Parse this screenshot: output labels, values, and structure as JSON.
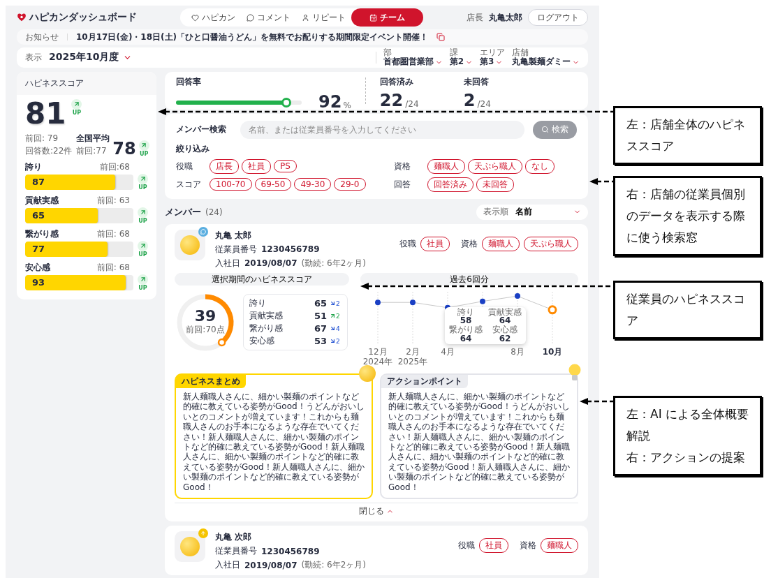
{
  "header": {
    "logo": "ハピカンダッシュボード",
    "nav": [
      {
        "label": "ハピカン",
        "selected": false
      },
      {
        "label": "コメント",
        "selected": false
      },
      {
        "label": "リピート",
        "selected": false
      },
      {
        "label": "チーム",
        "selected": true
      }
    ],
    "user_role": "店長",
    "user_name": "丸亀太郎",
    "logout": "ログアウト"
  },
  "notice": {
    "label": "お知らせ",
    "text": "10月17日(金)・18日(土)「ひと口醤油うどん」を無料でお配りする期間限定イベント開催！"
  },
  "period": {
    "label": "表示",
    "value": "2025年10月度",
    "filters": [
      {
        "label": "部",
        "value": "首都圏営業部"
      },
      {
        "label": "課",
        "value": "第2"
      },
      {
        "label": "エリア",
        "value": "第3"
      },
      {
        "label": "店舗",
        "value": "丸亀製麺ダミー"
      }
    ]
  },
  "happiness": {
    "title": "ハピネススコア",
    "score": "81",
    "trend_label": "UP",
    "previous": "前回: 79",
    "responses": "回答数:22件",
    "national_label": "全国平均",
    "national_previous": "前回:77",
    "national_score": "78",
    "national_trend_label": "UP",
    "metrics": [
      {
        "name": "誇り",
        "previous": "前回:68",
        "value": "87",
        "level": 0.83,
        "trend_label": "UP"
      },
      {
        "name": "貢献実感",
        "previous": "前回: 63",
        "value": "65",
        "level": 0.67,
        "trend_label": "UP"
      },
      {
        "name": "繋がり感",
        "previous": "前回: 68",
        "value": "77",
        "level": 0.76,
        "trend_label": "UP"
      },
      {
        "name": "安心感",
        "previous": "前回: 68",
        "value": "93",
        "level": 0.93,
        "trend_label": "UP"
      }
    ]
  },
  "response": {
    "label": "回答率",
    "level": 0.88,
    "value": "92",
    "unit": "%",
    "answered_label": "回答済み",
    "answered": "22",
    "answered_total": "/24",
    "unanswered_label": "未回答",
    "unanswered": "2",
    "unanswered_total": "/24"
  },
  "search": {
    "label": "メンバー検索",
    "placeholder": "名前、または従業員番号を入力してください",
    "button": "検索",
    "filter_title": "絞り込み",
    "groups": [
      {
        "label": "役職",
        "chips": [
          "店長",
          "社員",
          "PS"
        ]
      },
      {
        "label": "資格",
        "chips": [
          "麺職人",
          "天ぷら職人",
          "なし"
        ]
      },
      {
        "label": "スコア",
        "chips": [
          "100-70",
          "69-50",
          "49-30",
          "29-0"
        ]
      },
      {
        "label": "回答",
        "chips": [
          "回答済み",
          "未回答"
        ]
      }
    ]
  },
  "members": {
    "title": "メンバー",
    "count": "(24)",
    "sort_label": "表示順",
    "sort_value": "名前",
    "cards": [
      {
        "name": "丸亀 太郎",
        "badge": {
          "kind": "comment",
          "color": "#5aaee0"
        },
        "id_label": "従業員番号",
        "id": "1230456789",
        "join_label": "入社日",
        "join_date": "2019/08/07",
        "tenure": "(勤続: 6年2ヶ月)",
        "role_label": "役職",
        "roles": [
          "社員"
        ],
        "qual_label": "資格",
        "quals": [
          "麺職人",
          "天ぷら職人"
        ],
        "details": {
          "score_tab": "選択期間のハピネススコア",
          "history_tab": "過去6回分",
          "score": "39",
          "score_previous": "前回:70点",
          "metrics": [
            {
              "name": "誇り",
              "value": "65",
              "kind": "down",
              "delta": "2"
            },
            {
              "name": "貢献実感",
              "value": "51",
              "kind": "up",
              "delta": "2"
            },
            {
              "name": "繋がり感",
              "value": "67",
              "kind": "down",
              "delta": "4"
            },
            {
              "name": "安心感",
              "value": "53",
              "kind": "down",
              "delta": "2"
            }
          ],
          "history": [
            {
              "month": "12月",
              "year": "2024年",
              "selected": false
            },
            {
              "month": "2月",
              "year": "2025年",
              "selected": false
            },
            {
              "month": "4月",
              "selected": false
            },
            {
              "selected": false
            },
            {
              "month": "8月",
              "selected": false
            },
            {
              "month": "10月",
              "selected": true
            }
          ],
          "tooltip": [
            {
              "name": "誇り",
              "value": "58"
            },
            {
              "name": "貢献実感",
              "value": "64"
            },
            {
              "name": "繋がり感",
              "value": "64"
            },
            {
              "name": "安心感",
              "value": "62"
            }
          ],
          "notes": [
            {
              "kind": "summary",
              "title": "ハピネスまとめ",
              "text": "新人麺職人さんに、細かい製麺のポイントなど的確に教えている姿勢がGood！うどんがおいしいとのコメントが増えています！これからも麺職人さんのお手本になるような存在でいてください！新人麺職人さんに、細かい製麺のポイントなど的確に教えている姿勢がGood！新人麺職人さんに、細かい製麺のポイントなど的確に教えている姿勢がGood！新人麺職人さんに、細かい製麺のポイントなど的確に教えている姿勢がGood！"
            },
            {
              "kind": "action",
              "title": "アクションポイント",
              "text": "新人麺職人さんに、細かい製麺のポイントなど的確に教えている姿勢がGood！うどんがおいしいとのコメントが増えています！これからも麺職人さんのお手本になるような存在でいてください！新人麺職人さんに、細かい製麺のポイントなど的確に教えている姿勢がGood！新人麺職人さんに、細かい製麺のポイントなど的確に教えている姿勢がGood！新人麺職人さんに、細かい製麺のポイントなど的確に教えている姿勢がGood！"
            }
          ],
          "close": "閉じる"
        }
      },
      {
        "name": "丸亀 次郎",
        "badge": {
          "kind": "up",
          "color": "#f5c400"
        },
        "id_label": "従業員番号",
        "id": "1230456789",
        "join_label": "入社日",
        "join_date": "2019/08/07",
        "tenure": "(勤続: 6年2ヶ月)",
        "role_label": "役職",
        "roles": [
          "社員"
        ],
        "qual_label": "資格",
        "quals": [
          "麺職人"
        ]
      }
    ]
  },
  "annotations": [
    {
      "lines": [
        "左：店舗全体のハピネススコア"
      ]
    },
    {
      "lines": [
        "右：店舗の従業員個別のデータを表示する際に使う検索窓"
      ]
    },
    {
      "lines": [
        "従業員のハピネススコア"
      ]
    },
    {
      "lines": [
        "左：AI による全体概要解説",
        "右：アクションの提案"
      ]
    }
  ]
}
